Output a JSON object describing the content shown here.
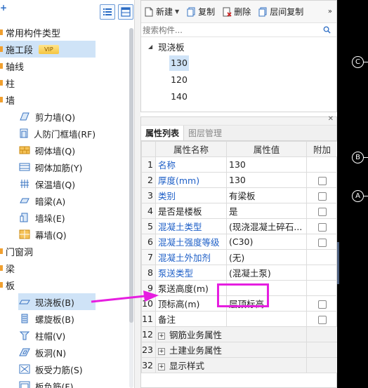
{
  "left_panel": {
    "toolbar_add": "+",
    "tree": [
      {
        "label": "常用构件类型"
      },
      {
        "label": "施工段",
        "badge": "VIP"
      },
      {
        "label": "轴线"
      },
      {
        "label": "柱"
      },
      {
        "label": "墙"
      }
    ],
    "wall_children": [
      {
        "label": "剪力墙(Q)",
        "icon": "shear-wall-icon"
      },
      {
        "label": "人防门框墙(RF)",
        "icon": "civil-defense-door-frame-icon"
      },
      {
        "label": "砌体墙(Q)",
        "icon": "masonry-wall-icon"
      },
      {
        "label": "砌体加筋(Y)",
        "icon": "masonry-reinforcement-icon"
      },
      {
        "label": "保温墙(Q)",
        "icon": "insulation-wall-icon"
      },
      {
        "label": "暗梁(A)",
        "icon": "hidden-beam-icon"
      },
      {
        "label": "墙垛(E)",
        "icon": "wall-pier-icon"
      },
      {
        "label": "幕墙(Q)",
        "icon": "curtain-wall-icon"
      }
    ],
    "tree2": [
      {
        "label": "门窗洞"
      },
      {
        "label": "梁"
      },
      {
        "label": "板"
      }
    ],
    "slab_children": [
      {
        "label": "现浇板(B)",
        "icon": "cast-slab-icon",
        "selected": true
      },
      {
        "label": "螺旋板(B)",
        "icon": "spiral-slab-icon"
      },
      {
        "label": "柱帽(V)",
        "icon": "column-cap-icon"
      },
      {
        "label": "板洞(N)",
        "icon": "slab-hole-icon"
      },
      {
        "label": "板受力筋(S)",
        "icon": "slab-stress-rebar-icon"
      },
      {
        "label": "板负筋(F)",
        "icon": "slab-negative-rebar-icon"
      }
    ]
  },
  "component_panel": {
    "toolbar": {
      "new_label": "新建",
      "copy_label": "复制",
      "delete_label": "删除",
      "floor_copy_label": "层间复制",
      "more": "»"
    },
    "search_placeholder": "搜索构件...",
    "category": "现浇板",
    "items": [
      {
        "label": "130",
        "selected": true
      },
      {
        "label": "120"
      },
      {
        "label": "140"
      }
    ]
  },
  "property_panel": {
    "tabs": [
      {
        "label": "属性列表",
        "active": true
      },
      {
        "label": "图层管理"
      }
    ],
    "columns": [
      "属性名称",
      "属性值",
      "附加"
    ],
    "rows": [
      {
        "num": "1",
        "name": "名称",
        "value": "130",
        "blue": true,
        "checkbox": false
      },
      {
        "num": "2",
        "name": "厚度(mm)",
        "value": "130",
        "blue": true,
        "checkbox": true
      },
      {
        "num": "3",
        "name": "类别",
        "value": "有梁板",
        "blue": true,
        "checkbox": true
      },
      {
        "num": "4",
        "name": "是否是楼板",
        "value": "是",
        "blue": false,
        "checkbox": true
      },
      {
        "num": "5",
        "name": "混凝土类型",
        "value": "(现浇混凝土碎石...",
        "blue": true,
        "checkbox": true
      },
      {
        "num": "6",
        "name": "混凝土强度等级",
        "value": "(C30)",
        "blue": true,
        "checkbox": true
      },
      {
        "num": "7",
        "name": "混凝土外加剂",
        "value": "(无)",
        "blue": true,
        "checkbox": false
      },
      {
        "num": "8",
        "name": "泵送类型",
        "value": "(混凝土泵)",
        "blue": true,
        "checkbox": false
      },
      {
        "num": "9",
        "name": "泵送高度(m)",
        "value": "",
        "blue": false,
        "checkbox": false
      },
      {
        "num": "10",
        "name": "顶标高(m)",
        "value": "层顶标高",
        "blue": false,
        "checkbox": true
      },
      {
        "num": "11",
        "name": "备注",
        "value": "",
        "blue": false,
        "checkbox": true
      }
    ],
    "groups": [
      {
        "num": "12",
        "expander": "+",
        "name": "钢筋业务属性"
      },
      {
        "num": "23",
        "expander": "+",
        "name": "土建业务属性"
      },
      {
        "num": "32",
        "expander": "+",
        "name": "显示样式"
      }
    ]
  },
  "canvas": {
    "axis_labels": [
      "C",
      "B",
      "A"
    ]
  },
  "colors": {
    "highlight": "#e61ee0",
    "selection": "#cfe3f7",
    "link_blue": "#1e5fc7"
  }
}
